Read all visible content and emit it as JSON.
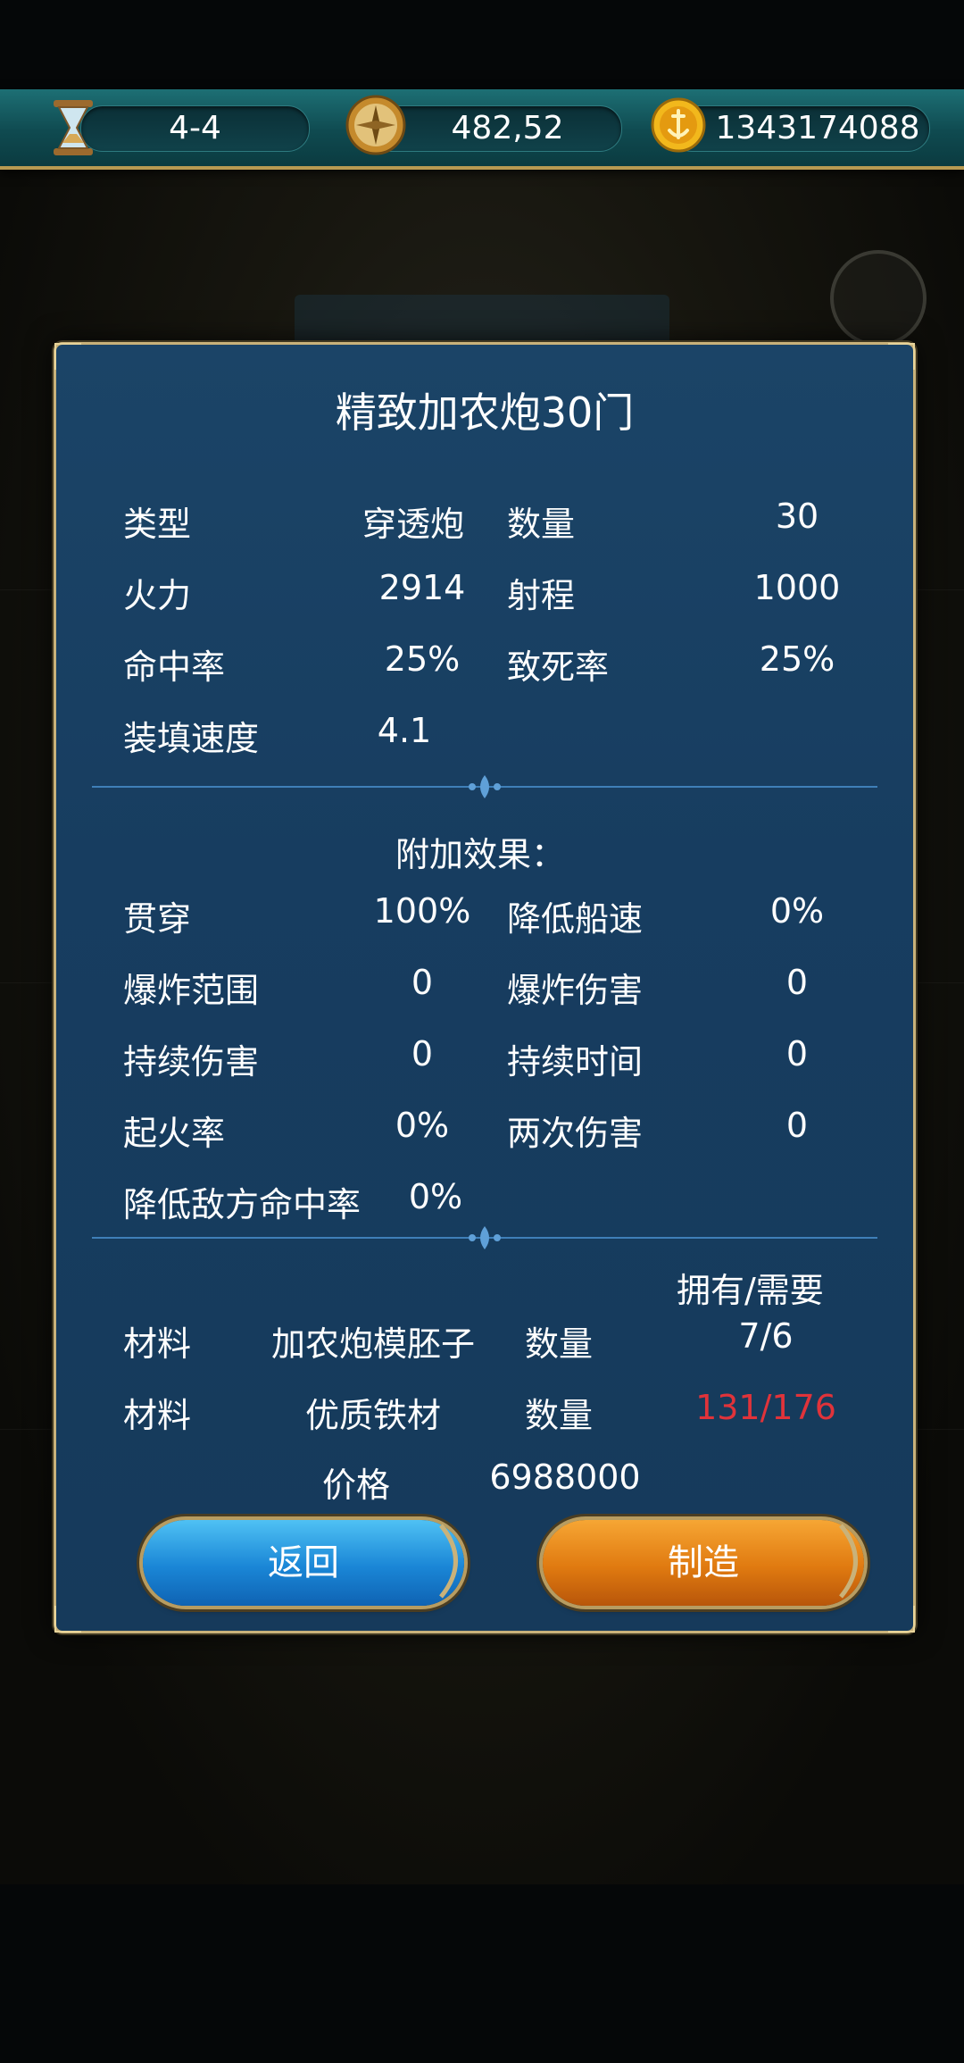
{
  "topbar": {
    "time_value": "4-4",
    "coord_value": "482,52",
    "gold_value": "1343174088",
    "icons": [
      "hourglass-icon",
      "compass-icon",
      "gold-coin-icon"
    ]
  },
  "dialog": {
    "title": "精致加农炮30门",
    "stats": {
      "type_label": "类型",
      "type_value": "穿透炮",
      "count_label": "数量",
      "count_value": "30",
      "firepower_label": "火力",
      "firepower_value": "2914",
      "range_label": "射程",
      "range_value": "1000",
      "accuracy_label": "命中率",
      "accuracy_value": "25%",
      "lethality_label": "致死率",
      "lethality_value": "25%",
      "reload_label": "装填速度",
      "reload_value": "4.1"
    },
    "effects": {
      "heading": "附加效果：",
      "pierce_label": "贯穿",
      "pierce_value": "100%",
      "slow_label": "降低船速",
      "slow_value": "0%",
      "blast_range_label": "爆炸范围",
      "blast_range_value": "0",
      "blast_damage_label": "爆炸伤害",
      "blast_damage_value": "0",
      "dot_label": "持续伤害",
      "dot_value": "0",
      "duration_label": "持续时间",
      "duration_value": "0",
      "ignite_label": "起火率",
      "ignite_value": "0%",
      "double_label": "两次伤害",
      "double_value": "0",
      "reduce_hit_label": "降低敌方命中率",
      "reduce_hit_value": "0%"
    },
    "materials": {
      "header": "拥有/需要",
      "rows": [
        {
          "label": "材料",
          "name": "加农炮模胚子",
          "qty_label": "数量",
          "qty": "7/6"
        },
        {
          "label": "材料",
          "name": "优质铁材",
          "qty_label": "数量",
          "qty": "131/176"
        }
      ],
      "shortage_color": "#e0333a"
    },
    "price_label": "价格",
    "price_value": "6988000",
    "back_button": "返回",
    "make_button": "制造"
  },
  "colors": {
    "back_button": "#1a86d6",
    "make_button": "#e07a10",
    "panel": "#173d60",
    "border_gold": "#c9b27a"
  }
}
